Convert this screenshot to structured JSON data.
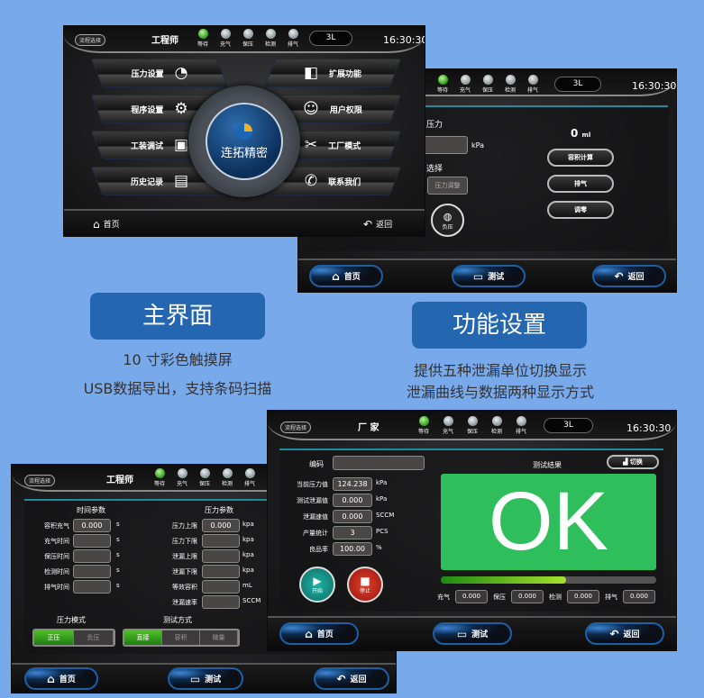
{
  "colors": {
    "background": "#78a9ea",
    "caption": "#2566b0",
    "ok_green": "#2fbe5c",
    "active_green": "#2e9a1c",
    "accent_blue": "#1d5fa5"
  },
  "status": {
    "flow_select": "流程选择",
    "volume": "3L",
    "time": "16:30:30",
    "lights": [
      {
        "label": "等待",
        "on": true
      },
      {
        "label": "充气",
        "on": false
      },
      {
        "label": "保压",
        "on": false
      },
      {
        "label": "检测",
        "on": false
      },
      {
        "label": "排气",
        "on": false
      }
    ]
  },
  "main_screen": {
    "role": "工程师",
    "menu_left": [
      {
        "label": "压力设置",
        "icon": "gauge-icon"
      },
      {
        "label": "程序设置",
        "icon": "gear-icon"
      },
      {
        "label": "工装调试",
        "icon": "chip-icon"
      },
      {
        "label": "历史记录",
        "icon": "notebook-icon"
      }
    ],
    "menu_right": [
      {
        "label": "扩展功能",
        "icon": "door-icon"
      },
      {
        "label": "用户权限",
        "icon": "user-icon"
      },
      {
        "label": "工厂模式",
        "icon": "tools-icon"
      },
      {
        "label": "联系我们",
        "icon": "phone-icon"
      }
    ],
    "brand": "连拓精密",
    "home": "首页",
    "back": "返回"
  },
  "function_screen": {
    "pressure_label": "压力",
    "pressure_unit": "kPa",
    "select_label": "选择",
    "adjust_button": "压力调整",
    "negative_button": "负压",
    "volume_value": "0",
    "volume_unit": "ml",
    "buttons": [
      "容积计算",
      "排气",
      "调零"
    ],
    "nav": {
      "home": "首页",
      "test": "测试",
      "back": "返回"
    }
  },
  "captions": {
    "main": {
      "title": "主界面",
      "lines": [
        "10 寸彩色触摸屏",
        "USB数据导出，支持条码扫描"
      ]
    },
    "function": {
      "title": "功能设置",
      "lines": [
        "提供五种泄漏单位切换显示",
        "泄漏曲线与数据两种显示方式"
      ]
    }
  },
  "test_screen": {
    "role": "厂 家",
    "code_label": "编码",
    "code_value": "",
    "rows": [
      {
        "label": "当前压力值",
        "value": "124.238",
        "unit": "kPa"
      },
      {
        "label": "测试泄漏值",
        "value": "0.000",
        "unit": "kPa"
      },
      {
        "label": "泄漏速值",
        "value": "0.000",
        "unit": "SCCM"
      },
      {
        "label": "产量统计",
        "value": "3",
        "unit": "PCS"
      },
      {
        "label": "良品率",
        "value": "100.00",
        "unit": "%"
      }
    ],
    "result_title": "测试结果",
    "switch_button": "切换",
    "result": "OK",
    "progress_percent": 58,
    "phases": [
      {
        "label": "充气",
        "value": "0.000"
      },
      {
        "label": "保压",
        "value": "0.000"
      },
      {
        "label": "检测",
        "value": "0.000"
      },
      {
        "label": "排气",
        "value": "0.000"
      }
    ],
    "start": "开始",
    "stop": "停止",
    "nav": {
      "home": "首页",
      "test": "测试",
      "back": "返回"
    }
  },
  "param_screen": {
    "role": "工程师",
    "time_title": "时间参数",
    "time_rows": [
      {
        "label": "容积充气",
        "value": "0.000",
        "unit": "s"
      },
      {
        "label": "充气时间",
        "value": "",
        "unit": "s"
      },
      {
        "label": "保压时间",
        "value": "",
        "unit": "s"
      },
      {
        "label": "检测时间",
        "value": "",
        "unit": "s"
      },
      {
        "label": "排气时间",
        "value": "",
        "unit": "s"
      }
    ],
    "pressure_title": "压力参数",
    "pressure_rows": [
      {
        "label": "压力上限",
        "value": "0.000",
        "unit": "kpa"
      },
      {
        "label": "压力下限",
        "value": "",
        "unit": "kpa"
      },
      {
        "label": "泄漏上限",
        "value": "",
        "unit": "kpa"
      },
      {
        "label": "泄漏下限",
        "value": "",
        "unit": "kpa"
      },
      {
        "label": "等效容积",
        "value": "",
        "unit": "mL"
      },
      {
        "label": "泄漏速率",
        "value": "",
        "unit": "SCCM"
      }
    ],
    "mode_title": "压力模式",
    "modes": [
      {
        "label": "正压",
        "on": true
      },
      {
        "label": "负压",
        "on": false
      }
    ],
    "method_title": "测试方式",
    "methods": [
      {
        "label": "直接",
        "on": true
      },
      {
        "label": "容积",
        "on": false
      },
      {
        "label": "微量",
        "on": false
      }
    ],
    "nav": {
      "home": "首页",
      "test": "测试",
      "back": "返回"
    }
  }
}
